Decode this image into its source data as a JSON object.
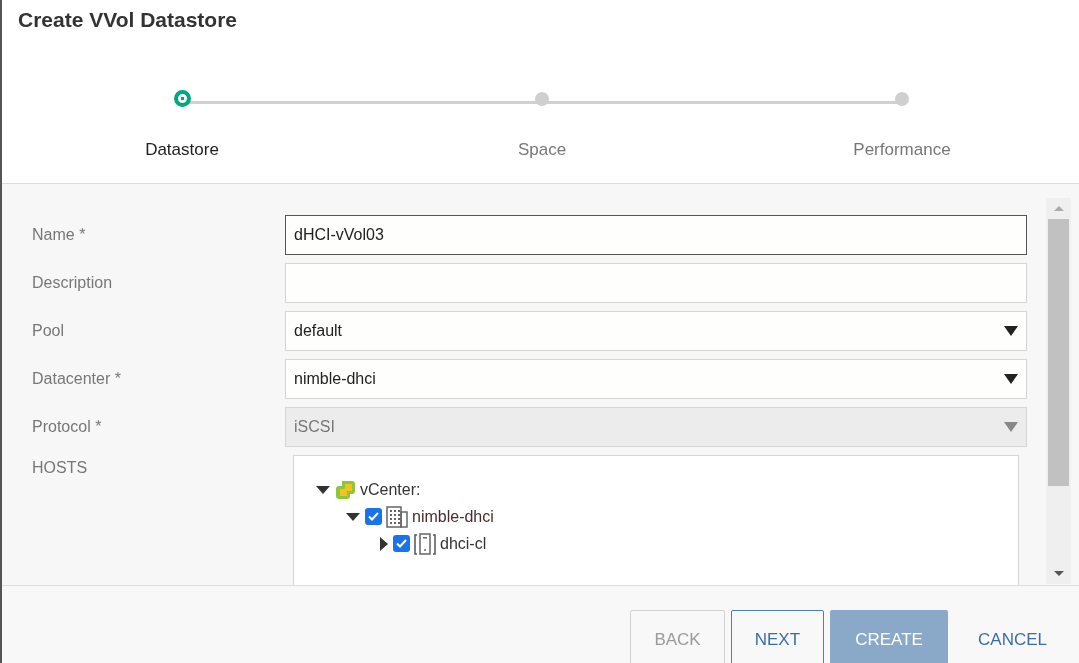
{
  "window": {
    "title": "Create VVol Datastore"
  },
  "steps": [
    {
      "label": "Datastore",
      "selected": true
    },
    {
      "label": "Space",
      "selected": false
    },
    {
      "label": "Performance",
      "selected": false
    }
  ],
  "fields": [
    {
      "label": "Name *",
      "kind": "text",
      "value": "dHCI-vVol03"
    },
    {
      "label": "Description",
      "kind": "text"
    },
    {
      "label": "Pool",
      "kind": "select",
      "value": "default"
    },
    {
      "label": "Datacenter *",
      "kind": "select",
      "value": "nimble-dhci"
    },
    {
      "label": "Protocol *",
      "kind": "select",
      "value": "iSCSI",
      "disabled": true
    }
  ],
  "hosts": {
    "label": "HOSTS",
    "tree": [
      {
        "label": "vCenter:",
        "kind": "vcenter",
        "expanded": true,
        "children": [
          {
            "label": "nimble-dhci",
            "kind": "datacenter",
            "checked": true,
            "expanded": true,
            "children": [
              {
                "label": "dhci-cl",
                "kind": "cluster",
                "checked": true,
                "expanded": false
              }
            ]
          }
        ]
      }
    ]
  },
  "buttons": [
    {
      "label": "BACK",
      "kind": "outline",
      "disabled": true
    },
    {
      "label": "NEXT",
      "kind": "outline",
      "disabled": false
    },
    {
      "label": "CREATE",
      "kind": "primary",
      "disabled": true
    },
    {
      "label": "CANCEL",
      "kind": "text",
      "disabled": false
    }
  ]
}
